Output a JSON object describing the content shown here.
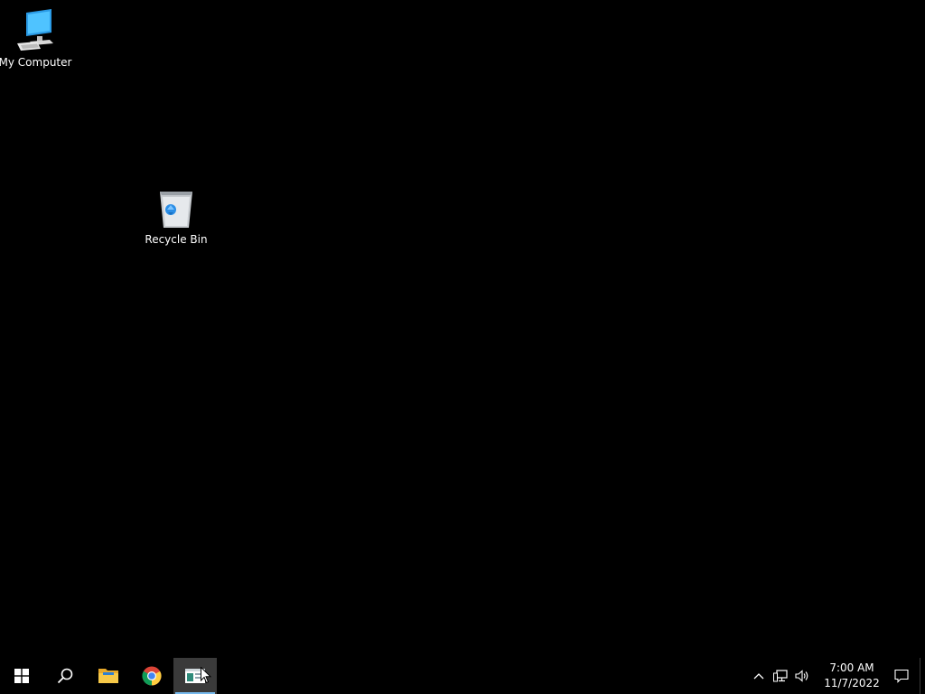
{
  "desktop": {
    "background_color": "#000000",
    "icons": [
      {
        "label": "My Computer",
        "icon": "computer-icon"
      },
      {
        "label": "Recycle Bin",
        "icon": "recycle-bin-icon"
      }
    ]
  },
  "taskbar": {
    "start": {
      "icon": "windows-logo-icon"
    },
    "search": {
      "icon": "search-icon"
    },
    "pinned": [
      {
        "icon": "file-explorer-icon",
        "running": false
      },
      {
        "icon": "chrome-icon",
        "running": false
      },
      {
        "icon": "app-window-icon",
        "running": true,
        "active": true
      }
    ],
    "accent_color": "#76b9ed"
  },
  "tray": {
    "overflow_icon": "chevron-up-icon",
    "network_icon": "network-icon",
    "volume_icon": "speaker-icon",
    "time": "7:00 AM",
    "date": "11/7/2022",
    "notification_icon": "action-center-icon"
  }
}
